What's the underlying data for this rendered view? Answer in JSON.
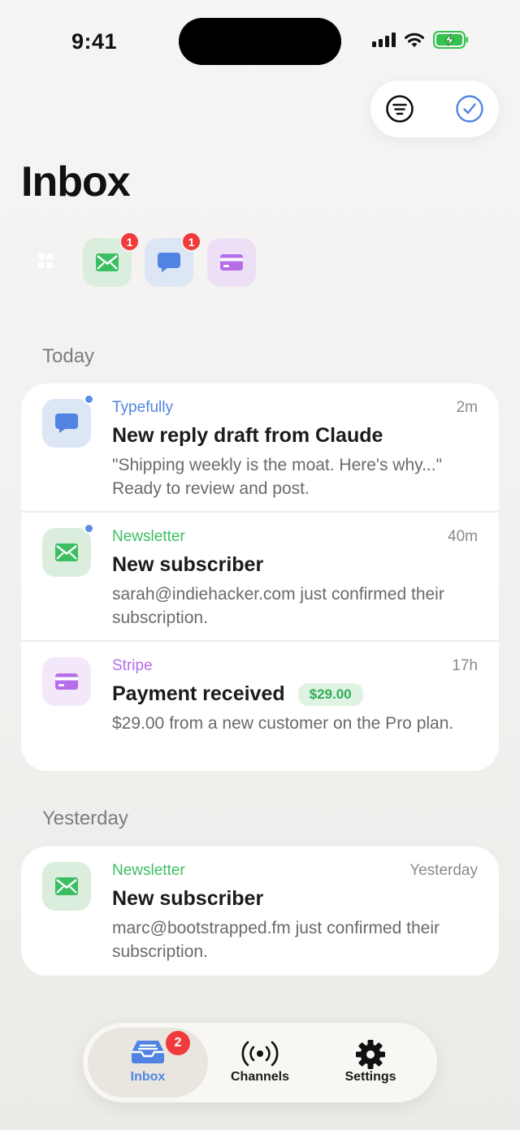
{
  "status_bar": {
    "time": "9:41"
  },
  "header": {
    "title": "Inbox"
  },
  "channel_chips": [
    {
      "id": "all",
      "badge": ""
    },
    {
      "id": "newsletter",
      "badge": "1"
    },
    {
      "id": "typefully",
      "badge": "1"
    },
    {
      "id": "stripe",
      "badge": ""
    }
  ],
  "sections": [
    {
      "label": "Today",
      "items": [
        {
          "source": "Typefully",
          "time": "2m",
          "title": "New reply draft from Claude",
          "body": "\"Shipping weekly is the moat. Here's why...\" Ready to review and post.",
          "unread": true
        },
        {
          "source": "Newsletter",
          "time": "40m",
          "title": "New subscriber",
          "body": "sarah@indiehacker.com just confirmed their subscription.",
          "unread": true
        },
        {
          "source": "Stripe",
          "time": "17h",
          "title": "Payment received",
          "amount": "$29.00",
          "body": "$29.00 from a new customer on the Pro plan.",
          "unread": false
        }
      ]
    },
    {
      "label": "Yesterday",
      "items": [
        {
          "source": "Newsletter",
          "time": "Yesterday",
          "title": "New subscriber",
          "body": "marc@bootstrapped.fm just confirmed their subscription.",
          "unread": false
        }
      ]
    }
  ],
  "tab_bar": {
    "tabs": [
      {
        "label": "Inbox",
        "badge": "2",
        "active": true
      },
      {
        "label": "Channels"
      },
      {
        "label": "Settings"
      }
    ]
  },
  "colors": {
    "accent_blue": "#5184e2",
    "newsletter_green": "#3cbf62",
    "stripe_purple": "#b56ee8",
    "badge_red": "#ef3b3b"
  }
}
